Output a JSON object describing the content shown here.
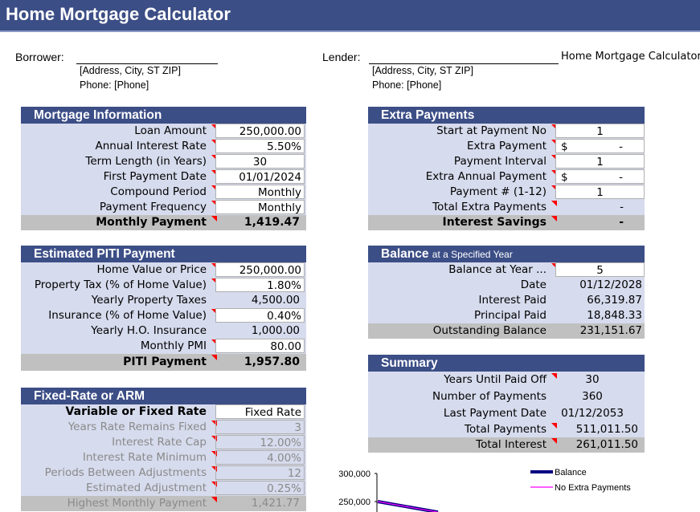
{
  "app": {
    "title": "Home Mortgage Calculator"
  },
  "borrower": {
    "label": "Borrower:",
    "address": "[Address, City, ST ZIP]",
    "phone": "Phone: [Phone]"
  },
  "lender": {
    "label": "Lender:",
    "address": "[Address, City, ST ZIP]",
    "phone": "Phone: [Phone]"
  },
  "side_note": "Home Mortgage Calculator",
  "mortgage_info": {
    "title": "Mortgage Information",
    "rows": [
      {
        "label": "Loan Amount",
        "value": "250,000.00"
      },
      {
        "label": "Annual Interest Rate",
        "value": "5.50%"
      },
      {
        "label": "Term Length (in Years)",
        "value": "30"
      },
      {
        "label": "First Payment Date",
        "value": "01/01/2024"
      },
      {
        "label": "Compound Period",
        "value": "Monthly"
      },
      {
        "label": "Payment Frequency",
        "value": "Monthly"
      }
    ],
    "total": {
      "label": "Monthly Payment",
      "value": "1,419.47"
    }
  },
  "piti": {
    "title": "Estimated PITI Payment",
    "rows": [
      {
        "label": "Home Value or Price",
        "value": "250,000.00"
      },
      {
        "label": "Property Tax (% of Home Value)",
        "value": "1.80%"
      },
      {
        "label": "Yearly Property Taxes",
        "value": "4,500.00"
      },
      {
        "label": "Insurance (% of Home Value)",
        "value": "0.40%"
      },
      {
        "label": "Yearly H.O. Insurance",
        "value": "1,000.00"
      },
      {
        "label": "Monthly PMI",
        "value": "80.00"
      }
    ],
    "total": {
      "label": "PITI Payment",
      "value": "1,957.80"
    }
  },
  "arm": {
    "title": "Fixed-Rate or ARM",
    "selector": {
      "label": "Variable or Fixed Rate",
      "value": "Fixed Rate"
    },
    "rows": [
      {
        "label": "Years Rate Remains Fixed",
        "value": "3"
      },
      {
        "label": "Interest Rate Cap",
        "value": "12.00%"
      },
      {
        "label": "Interest Rate Minimum",
        "value": "4.00%"
      },
      {
        "label": "Periods Between Adjustments",
        "value": "12"
      },
      {
        "label": "Estimated Adjustment",
        "value": "0.25%"
      }
    ],
    "total": {
      "label": "Highest Monthly Payment",
      "value": "1,421.77"
    }
  },
  "extra": {
    "title": "Extra Payments",
    "rows": [
      {
        "label": "Start at Payment No",
        "value": "1",
        "currency": ""
      },
      {
        "label": "Extra Payment",
        "value": "-",
        "currency": "$"
      },
      {
        "label": "Payment Interval",
        "value": "1",
        "currency": ""
      },
      {
        "label": "Extra Annual Payment",
        "value": "-",
        "currency": "$"
      },
      {
        "label": "Payment # (1-12)",
        "value": "1",
        "currency": ""
      },
      {
        "label": "Total Extra Payments",
        "value": "-"
      }
    ],
    "total": {
      "label": "Interest Savings",
      "value": "-"
    }
  },
  "balance": {
    "title": "Balance",
    "subtitle": "at a Specified Year",
    "rows": [
      {
        "label": "Balance at Year ...",
        "value": "5"
      },
      {
        "label": "Date",
        "value": "01/12/2028"
      },
      {
        "label": "Interest Paid",
        "value": "66,319.87"
      },
      {
        "label": "Principal Paid",
        "value": "18,848.33"
      }
    ],
    "total": {
      "label": "Outstanding Balance",
      "value": "231,151.67"
    }
  },
  "summary": {
    "title": "Summary",
    "rows": [
      {
        "label": "Years Until Paid Off",
        "value": "30"
      },
      {
        "label": "Number of Payments",
        "value": "360"
      },
      {
        "label": "Last Payment Date",
        "value": "01/12/2053"
      },
      {
        "label": "Total Payments",
        "value": "511,011.50"
      }
    ],
    "total": {
      "label": "Total Interest",
      "value": "261,011.50"
    }
  },
  "colors": {
    "header": "#3c4e86",
    "row": "#d6dbed",
    "total": "#c0c0c0",
    "balance_line": "#000080",
    "no_extra_line": "#ff00ff",
    "comment_marker": "#ff0000"
  },
  "chart_data": {
    "type": "line",
    "title": "",
    "xlabel": "",
    "ylabel": "",
    "y_ticks": [
      "300,000",
      "250,000"
    ],
    "ylim": [
      0,
      300000
    ],
    "legend": {
      "position": "top-right",
      "entries": [
        "Balance",
        "No Extra Payments"
      ]
    },
    "series": [
      {
        "name": "Balance",
        "x": [
          0,
          5
        ],
        "values": [
          250000,
          231151.67
        ]
      },
      {
        "name": "No Extra Payments",
        "x": [
          0,
          5
        ],
        "values": [
          250000,
          231151.67
        ]
      }
    ]
  }
}
